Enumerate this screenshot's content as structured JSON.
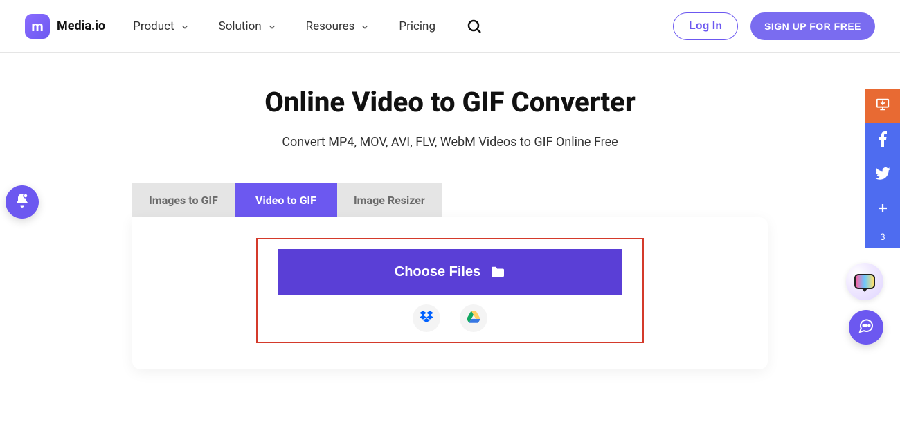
{
  "brand": {
    "name": "Media.io",
    "logo_letter": "m"
  },
  "nav": {
    "items": [
      {
        "label": "Product"
      },
      {
        "label": "Solution"
      },
      {
        "label": "Resoures"
      },
      {
        "label": "Pricing"
      }
    ]
  },
  "auth": {
    "login": "Log In",
    "signup": "SIGN UP FOR FREE"
  },
  "page": {
    "title": "Online Video to GIF Converter",
    "subtitle": "Convert MP4, MOV, AVI, FLV, WebM Videos to GIF Online Free"
  },
  "tabs": [
    {
      "label": "Images to GIF",
      "active": false
    },
    {
      "label": "Video to GIF",
      "active": true
    },
    {
      "label": "Image Resizer",
      "active": false
    }
  ],
  "upload": {
    "choose_label": "Choose Files",
    "cloud_options": [
      "dropbox",
      "google-drive"
    ]
  },
  "share": {
    "count": "3"
  }
}
